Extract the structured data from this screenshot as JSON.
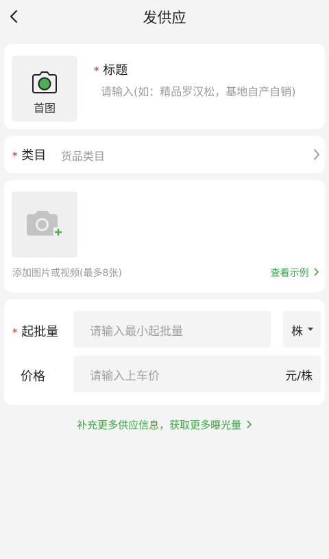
{
  "nav": {
    "title": "发供应",
    "back_icon": "chevron-left-icon"
  },
  "cover": {
    "label": "首图",
    "icon": "camera-icon",
    "accent": "#4caf50"
  },
  "title_field": {
    "required_mark": "*",
    "label": "标题",
    "placeholder": "请输入(如：精品罗汉松，基地自产自销)"
  },
  "category": {
    "required_mark": "*",
    "label": "类目",
    "value": "货品类目",
    "chevron": "chevron-right-icon"
  },
  "media": {
    "hint": "添加图片或视频(最多8张)",
    "example_link": "查看示例",
    "icon": "camera-add-icon"
  },
  "min_qty": {
    "required_mark": "*",
    "label": "起批量",
    "placeholder": "请输入最小起批量",
    "unit": "株"
  },
  "price": {
    "label": "价格",
    "placeholder": "请输入上车价",
    "unit": "元/株"
  },
  "footer": {
    "link": "补充更多供应信息，获取更多曝光量"
  },
  "colors": {
    "green": "#3aa645",
    "required": "#e02020",
    "bg": "#f4f4f4"
  }
}
